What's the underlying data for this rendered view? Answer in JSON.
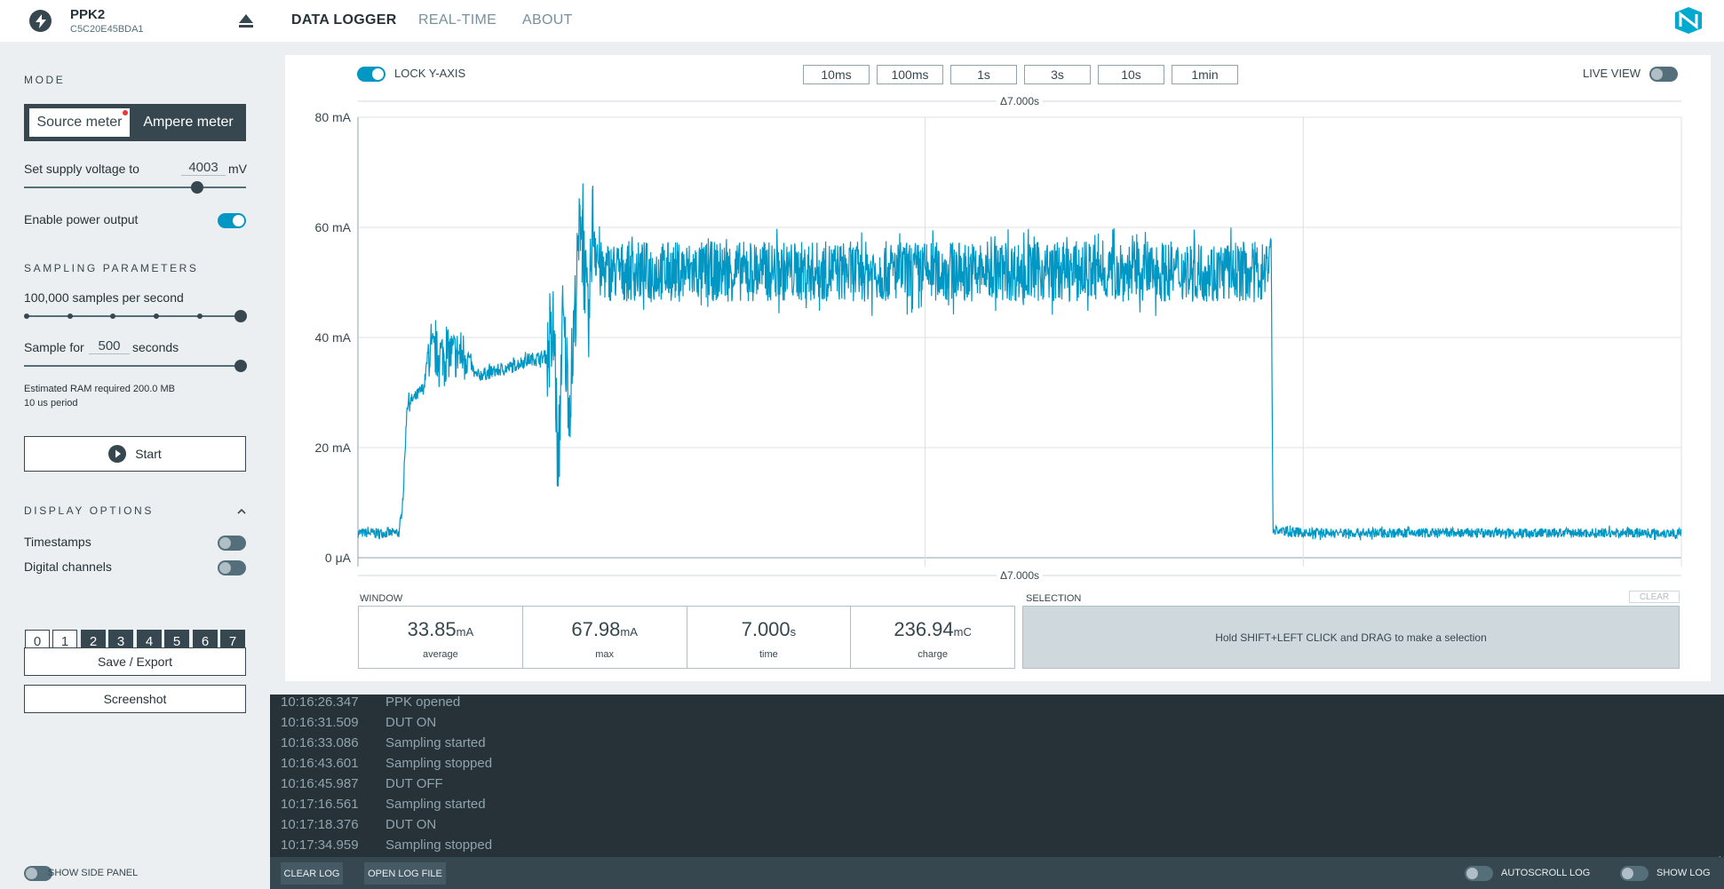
{
  "device": {
    "name": "PPK2",
    "serial": "C5C20E45BDA1"
  },
  "nav": {
    "tabs": [
      "DATA LOGGER",
      "REAL-TIME",
      "ABOUT"
    ],
    "active": "DATA LOGGER"
  },
  "side": {
    "mode_title": "MODE",
    "mode_source": "Source meter",
    "mode_ampere": "Ampere meter",
    "supply_label": "Set supply voltage to",
    "supply_value": "4003",
    "supply_unit": "mV",
    "supply_slider_fraction": 0.78,
    "enable_power_label": "Enable power output",
    "enable_power_on": true,
    "sampling_title": "SAMPLING PARAMETERS",
    "samples_label": "100,000 samples per second",
    "samples_step": 5,
    "sample_for_label": "Sample for",
    "sample_for_value": "500",
    "sample_for_unit": "seconds",
    "ram_label": "Estimated RAM required 200.0 MB",
    "period_label": "10 us period",
    "start_label": "Start",
    "display_title": "DISPLAY OPTIONS",
    "timestamps_label": "Timestamps",
    "digital_label": "Digital channels",
    "channels": [
      "0",
      "1",
      "2",
      "3",
      "4",
      "5",
      "6",
      "7"
    ],
    "save_label": "Save / Export",
    "screenshot_label": "Screenshot"
  },
  "chart": {
    "lock_label": "LOCK Y-AXIS",
    "live_label": "LIVE VIEW",
    "windows": [
      "10ms",
      "100ms",
      "1s",
      "3s",
      "10s",
      "1min"
    ],
    "delta_top": "Δ7.000s",
    "delta_bottom": "Δ7.000s",
    "y_ticks": [
      "80 mA",
      "60 mA",
      "40 mA",
      "20 mA",
      "0 μA"
    ]
  },
  "chart_data": {
    "type": "line",
    "title": "",
    "xlabel": "",
    "ylabel": "",
    "ylim": [
      0,
      80
    ],
    "y_unit": "mA",
    "x_range_s": [
      0,
      7.0
    ],
    "series": [
      {
        "color": "#0097c4",
        "points": [
          [
            0.0,
            4.5
          ],
          [
            0.22,
            4.5
          ],
          [
            0.24,
            12
          ],
          [
            0.26,
            28
          ],
          [
            0.3,
            29
          ],
          [
            0.35,
            31
          ],
          [
            0.37,
            37
          ],
          [
            0.58,
            37
          ],
          [
            0.62,
            33
          ],
          [
            0.8,
            34.5
          ],
          [
            0.9,
            36
          ],
          [
            1.0,
            36.5
          ],
          [
            1.04,
            40
          ],
          [
            1.06,
            12
          ],
          [
            1.08,
            44
          ],
          [
            1.12,
            28
          ],
          [
            1.16,
            52
          ],
          [
            1.18,
            64
          ],
          [
            1.22,
            40
          ],
          [
            1.24,
            62
          ],
          [
            1.28,
            52
          ],
          [
            2.0,
            52
          ],
          [
            3.0,
            52
          ],
          [
            4.0,
            52
          ],
          [
            4.8,
            52
          ],
          [
            4.83,
            58
          ],
          [
            4.84,
            5
          ],
          [
            5.0,
            4.5
          ],
          [
            6.0,
            4.5
          ],
          [
            7.0,
            4.5
          ]
        ]
      }
    ]
  },
  "stats": {
    "window_title": "WINDOW",
    "selection_title": "SELECTION",
    "clear_label": "CLEAR",
    "items": [
      {
        "value": "33.85",
        "unit": "mA",
        "label": "average"
      },
      {
        "value": "67.98",
        "unit": "mA",
        "label": "max"
      },
      {
        "value": "7.000",
        "unit": "s",
        "label": "time"
      },
      {
        "value": "236.94",
        "unit": "mC",
        "label": "charge"
      }
    ],
    "selection_hint": "Hold SHIFT+LEFT CLICK and DRAG to make a selection"
  },
  "log": [
    {
      "time": "10:16:26.347",
      "msg": "PPK opened"
    },
    {
      "time": "10:16:31.509",
      "msg": "DUT ON"
    },
    {
      "time": "10:16:33.086",
      "msg": "Sampling started"
    },
    {
      "time": "10:16:43.601",
      "msg": "Sampling stopped"
    },
    {
      "time": "10:16:45.987",
      "msg": "DUT OFF"
    },
    {
      "time": "10:17:16.561",
      "msg": "Sampling started"
    },
    {
      "time": "10:17:18.376",
      "msg": "DUT ON"
    },
    {
      "time": "10:17:34.959",
      "msg": "Sampling stopped"
    }
  ],
  "footer": {
    "show_side_panel": "SHOW SIDE PANEL",
    "clear_log": "CLEAR LOG",
    "open_log": "OPEN LOG FILE",
    "autoscroll": "AUTOSCROLL LOG",
    "show_log": "SHOW LOG"
  }
}
